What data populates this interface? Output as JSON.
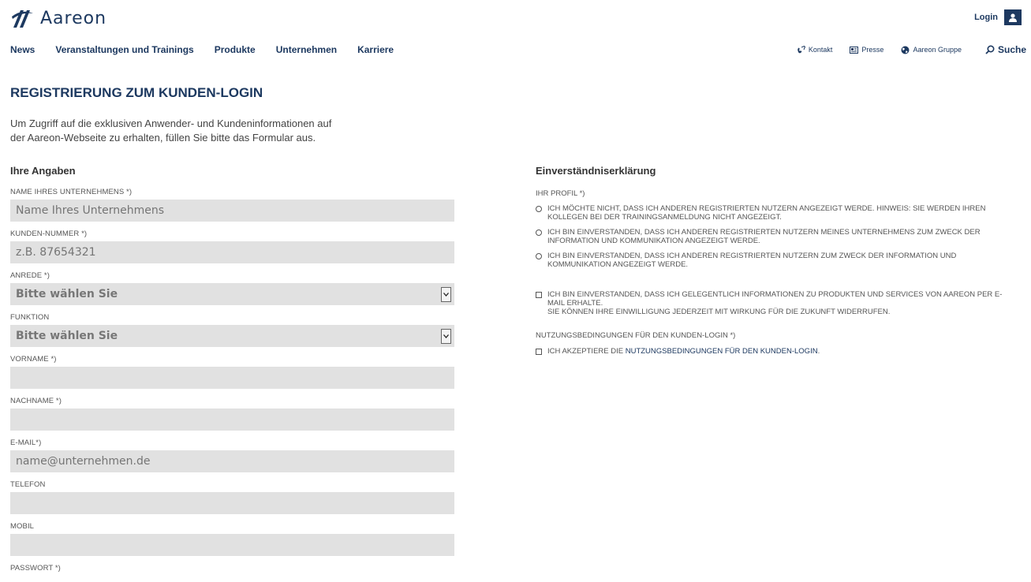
{
  "header": {
    "logo_text": "Aareon",
    "login_label": "Login"
  },
  "nav": {
    "items": [
      "News",
      "Veranstaltungen und Trainings",
      "Produkte",
      "Unternehmen",
      "Karriere"
    ]
  },
  "util": {
    "kontakt": "Kontakt",
    "presse": "Presse",
    "gruppe": "Aareon Gruppe",
    "suche": "Suche"
  },
  "page": {
    "title": "REGISTRIERUNG ZUM KUNDEN-LOGIN",
    "intro_line1": "Um Zugriff auf die exklusiven Anwender- und Kundeninformationen auf",
    "intro_line2": "der Aareon-Webseite zu erhalten, füllen Sie bitte das Formular aus."
  },
  "form": {
    "section_title": "Ihre Angaben",
    "company_label": "NAME IHRES UNTERNEHMENS *)",
    "company_placeholder": "Name Ihres Unternehmens",
    "customer_no_label": "KUNDEN-NUMMER *)",
    "customer_no_placeholder": "z.B. 87654321",
    "salutation_label": "ANREDE *)",
    "salutation_value": "Bitte wählen Sie",
    "function_label": "FUNKTION",
    "function_value": "Bitte wählen Sie",
    "firstname_label": "VORNAME *)",
    "lastname_label": "NACHNAME *)",
    "email_label": "E-MAIL*)",
    "email_placeholder": "name@unternehmen.de",
    "phone_label": "TELEFON",
    "mobile_label": "MOBIL",
    "password_label": "PASSWORT *)"
  },
  "consent": {
    "section_title": "Einverständniserklärung",
    "profile_label": "IHR PROFIL *)",
    "option1": "ICH MÖCHTE NICHT, DASS ICH ANDEREN REGISTRIERTEN NUTZERN ANGEZEIGT WERDE. HINWEIS: SIE WERDEN IHREN KOLLEGEN BEI DER TRAININGSANMELDUNG NICHT ANGEZEIGT.",
    "option2": "ICH BIN EINVERSTANDEN, DASS ICH ANDEREN REGISTRIERTEN NUTZERN MEINES UNTERNEHMENS ZUM ZWECK DER INFORMATION UND KOMMUNIKATION ANGEZEIGT WERDE.",
    "option3": "ICH BIN EINVERSTANDEN, DASS ICH ANDEREN REGISTRIERTEN NUTZERN ZUM ZWECK DER INFORMATION UND KOMMUNIKATION ANGEZEIGT WERDE.",
    "newsletter_line1": "ICH BIN EINVERSTANDEN, DASS ICH GELEGENTLICH INFORMATIONEN ZU PRODUKTEN UND SERVICES VON AAREON PER E-MAIL ERHALTE.",
    "newsletter_line2": "SIE KÖNNEN IHRE EINWILLIGUNG JEDERZEIT MIT WIRKUNG FÜR DIE ZUKUNFT WIDERRUFEN.",
    "terms_label": "NUTZUNGSBEDINGUNGEN FÜR DEN KUNDEN-LOGIN *)",
    "terms_prefix": "ICH AKZEPTIERE DIE ",
    "terms_link": "NUTZUNGSBEDINGUNGEN FÜR DEN KUNDEN-LOGIN",
    "terms_suffix": "."
  },
  "colors": {
    "brand": "#1d3960",
    "field_bg": "#e1e1e1"
  }
}
